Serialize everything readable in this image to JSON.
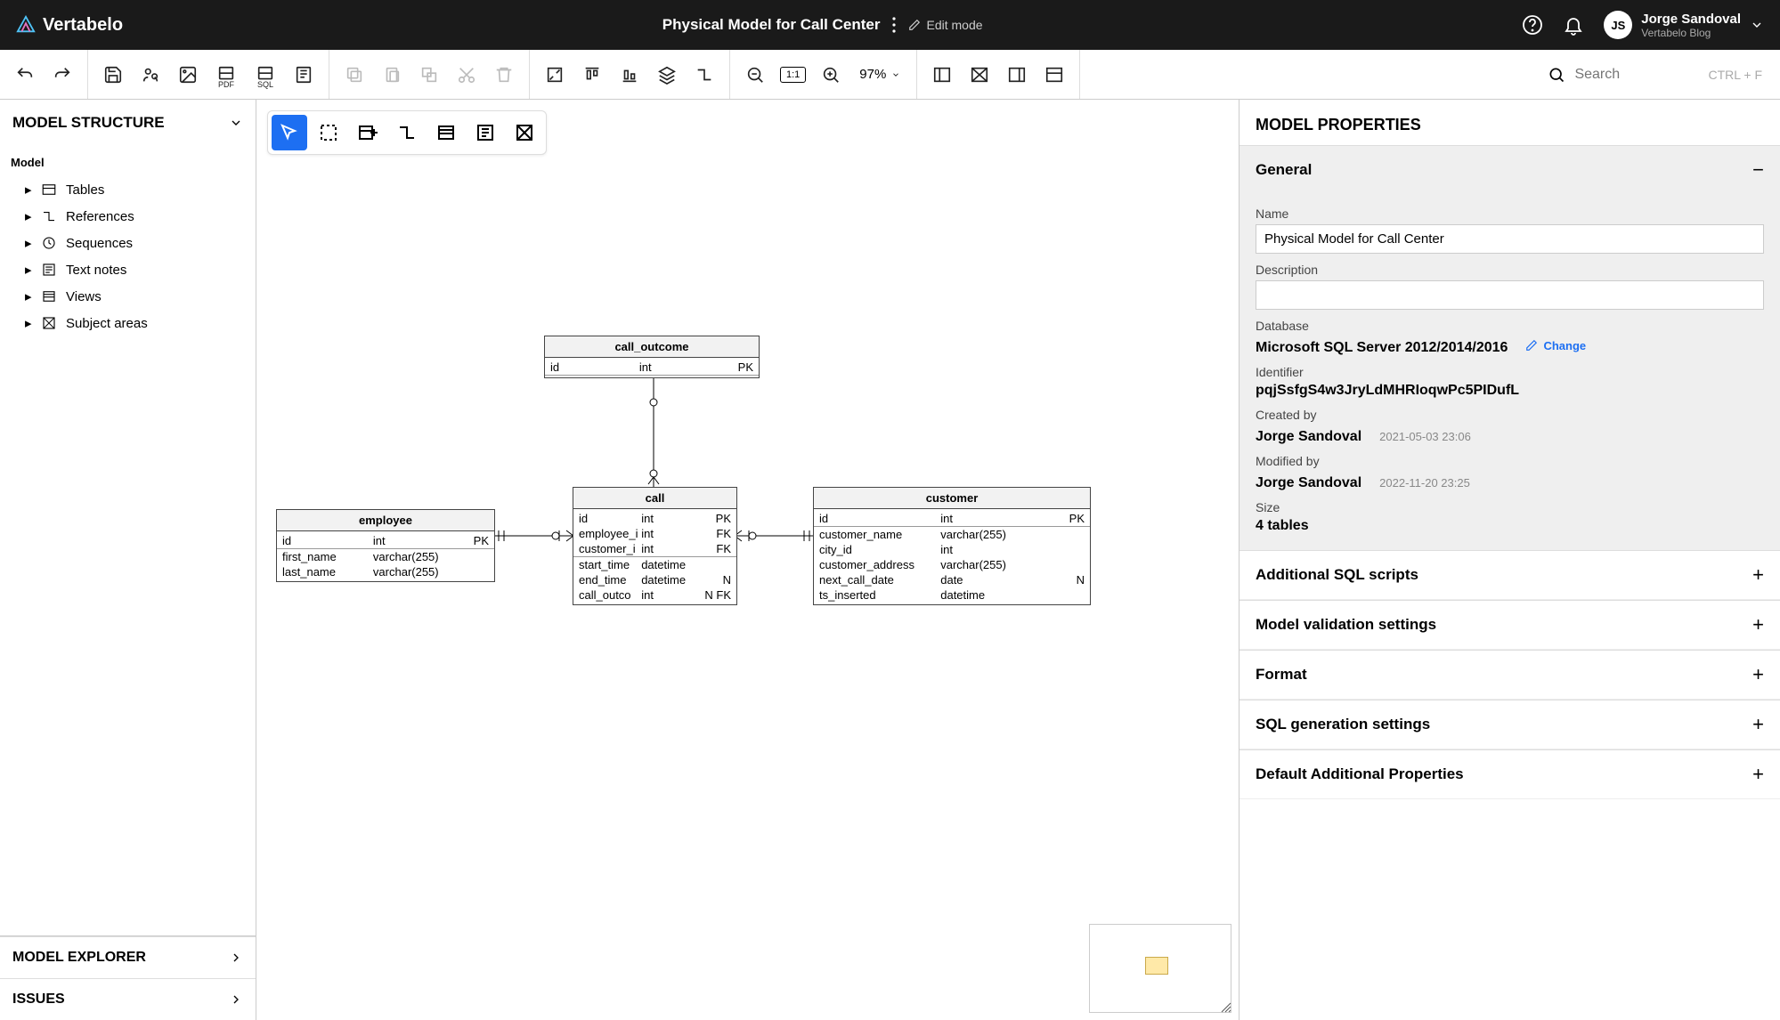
{
  "app": {
    "brand": "Vertabelo"
  },
  "header": {
    "title": "Physical Model for Call Center",
    "edit_mode": "Edit mode",
    "user_name": "Jorge Sandoval",
    "user_sub": "Vertabelo Blog",
    "avatar_initials": "JS"
  },
  "toolbar": {
    "zoom": "97%",
    "zoom_ratio": "1:1",
    "search_placeholder": "Search",
    "search_hint": "CTRL + F",
    "pdf_label": "PDF",
    "sql_label": "SQL"
  },
  "left": {
    "structure_title": "MODEL STRUCTURE",
    "root": "Model",
    "items": [
      {
        "label": "Tables",
        "icon": "table"
      },
      {
        "label": "References",
        "icon": "ref"
      },
      {
        "label": "Sequences",
        "icon": "seq"
      },
      {
        "label": "Text notes",
        "icon": "note"
      },
      {
        "label": "Views",
        "icon": "view"
      },
      {
        "label": "Subject areas",
        "icon": "area"
      }
    ],
    "explorer_title": "MODEL EXPLORER",
    "issues_title": "ISSUES"
  },
  "erd": {
    "tables": {
      "call_outcome": {
        "title": "call_outcome",
        "cols": [
          {
            "name": "id",
            "type": "int",
            "key": "PK",
            "pk_divider": true
          }
        ]
      },
      "employee": {
        "title": "employee",
        "cols": [
          {
            "name": "id",
            "type": "int",
            "key": "PK",
            "pk_divider": true
          },
          {
            "name": "first_name",
            "type": "varchar(255)",
            "key": ""
          },
          {
            "name": "last_name",
            "type": "varchar(255)",
            "key": ""
          }
        ]
      },
      "call": {
        "title": "call",
        "cols": [
          {
            "name": "id",
            "type": "int",
            "key": "PK"
          },
          {
            "name": "employee_i",
            "type": "int",
            "key": "FK"
          },
          {
            "name": "customer_i",
            "type": "int",
            "key": "FK",
            "pk_divider": true
          },
          {
            "name": "start_time",
            "type": "datetime",
            "key": ""
          },
          {
            "name": "end_time",
            "type": "datetime",
            "key": "N"
          },
          {
            "name": "call_outco",
            "type": "int",
            "key": "N FK"
          }
        ]
      },
      "customer": {
        "title": "customer",
        "cols": [
          {
            "name": "id",
            "type": "int",
            "key": "PK",
            "pk_divider": true
          },
          {
            "name": "customer_name",
            "type": "varchar(255)",
            "key": ""
          },
          {
            "name": "city_id",
            "type": "int",
            "key": ""
          },
          {
            "name": "customer_address",
            "type": "varchar(255)",
            "key": ""
          },
          {
            "name": "next_call_date",
            "type": "date",
            "key": "N"
          },
          {
            "name": "ts_inserted",
            "type": "datetime",
            "key": ""
          }
        ]
      }
    }
  },
  "right": {
    "title": "MODEL PROPERTIES",
    "general": {
      "header": "General",
      "name_label": "Name",
      "name_value": "Physical Model for Call Center",
      "desc_label": "Description",
      "desc_value": "",
      "db_label": "Database",
      "db_value": "Microsoft SQL Server 2012/2014/2016",
      "change": "Change",
      "id_label": "Identifier",
      "id_value": "pqjSsfgS4w3JryLdMHRIoqwPc5PIDufL",
      "created_label": "Created by",
      "created_name": "Jorge Sandoval",
      "created_date": "2021-05-03 23:06",
      "modified_label": "Modified by",
      "modified_name": "Jorge Sandoval",
      "modified_date": "2022-11-20 23:25",
      "size_label": "Size",
      "size_value": "4 tables"
    },
    "sections": [
      "Additional SQL scripts",
      "Model validation settings",
      "Format",
      "SQL generation settings",
      "Default Additional Properties"
    ]
  }
}
